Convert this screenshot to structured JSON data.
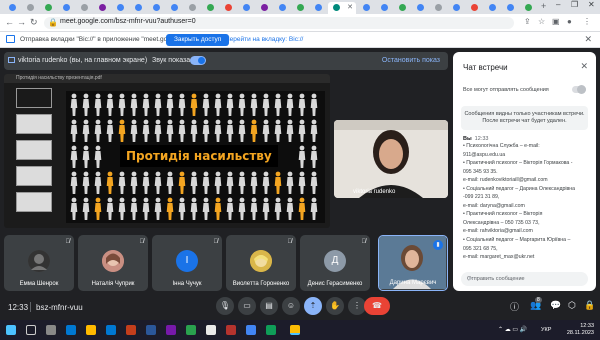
{
  "browser": {
    "url": "meet.google.com/bsz-mfnr-vuu?authuser=0",
    "infobar_message": "Отправка вкладки \"Вiс://\" в приложение \"meet.google.com\"...",
    "share_button": "Закрыть доступ",
    "goto_link": "Перейти на вкладку: Вiс://"
  },
  "presenter": {
    "label": "viktoria rudenko (вы, на главном экране)",
    "sound_label": "Звук показа",
    "stop_label": "Остановить показ"
  },
  "slide": {
    "header": "Протидія насильству презентація.pdf",
    "title": "Протидія насильству"
  },
  "self_view": {
    "name": "viktoria rudenko"
  },
  "participants": [
    {
      "name": "Емма Шенрок",
      "initial": "",
      "color": "#444"
    },
    {
      "name": "Наталія Чуприк",
      "initial": "",
      "color": "#b07070"
    },
    {
      "name": "Інна Чучук",
      "initial": "І",
      "color": "#1a73e8"
    },
    {
      "name": "Виолетта Гороненко",
      "initial": "",
      "color": "#c9a227"
    },
    {
      "name": "Денис Герасименко",
      "initial": "Д",
      "color": "#8d9aa8"
    },
    {
      "name": "Дарина Марєвич",
      "initial": "",
      "color": "#6b8fae"
    }
  ],
  "chat": {
    "title": "Чат встречи",
    "permit_label": "Все могут отправлять сообщения",
    "notice_line1": "Сообщения видны только участникам встречи.",
    "notice_line2": "После встречи чат будет удален.",
    "sender": "Вы",
    "time": "12:33",
    "lines": [
      "•     Психологічна Служба – e-mail:",
      "911@aspu.edu.ua",
      "•     Практичний психолог – Вікторія Гормакова -",
      "095 345 93 35.",
      "e-mail: rudenkoviktoriaill@gmail.com",
      "•     Соціальний педагог – Дарина Олександрівна",
      "-099 221 31 89,",
      "e-mail: daryna@gmail.com",
      "•     Практичний психолог – Вікторія",
      "Олександрівна – 050 735 03 73,",
      "e-mail: rahviktoria@gmail.com",
      "•     Соціальний педагог – Маргарита Юріївна –",
      "095 321 68 75,",
      "e-mail: margaret_max@ukr.net"
    ],
    "input_placeholder": "Отправить сообщение"
  },
  "bottom_bar": {
    "time": "12:33",
    "meeting_code": "bsz-mfnr-vuu",
    "participants_badge": "8"
  },
  "taskbar": {
    "lang": "УКР",
    "time": "12:33",
    "date": "28.11.2023"
  },
  "colors": {
    "accent": "#1a73e8",
    "end_call": "#ea4335",
    "slide_text": "#f3a521"
  }
}
